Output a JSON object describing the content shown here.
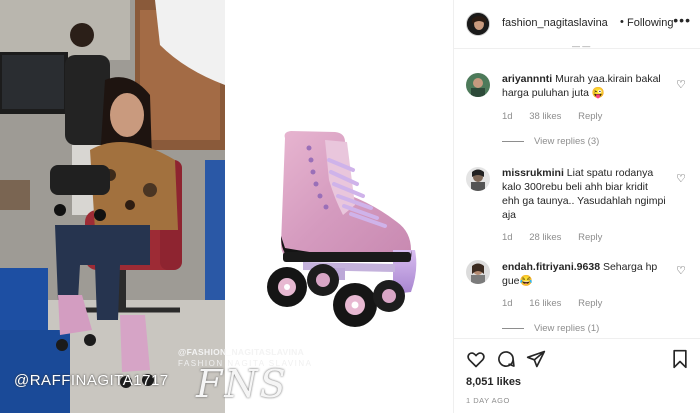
{
  "header": {
    "username": "fashion_nagitaslavina",
    "separator": "•",
    "follow_status": "Following",
    "more_icon": "more-horizontal-icon"
  },
  "comments": [
    {
      "username": "ariyannnti",
      "text": "Murah yaa.kirain bakal harga puluhan juta 😜",
      "time": "1d",
      "likes": "38 likes",
      "reply_label": "Reply",
      "view_replies": "View replies (3)"
    },
    {
      "username": "missrukmini",
      "text": "Liat spatu rodanya kalo 300rebu beli ahh biar kridit ehh ga taunya.. Yasudahlah ngimpi aja",
      "time": "1d",
      "likes": "28 likes",
      "reply_label": "Reply"
    },
    {
      "username": "endah.fitriyani.9638",
      "text": "Seharga hp gue😂",
      "time": "1d",
      "likes": "16 likes",
      "reply_label": "Reply",
      "view_replies": "View replies (1)"
    }
  ],
  "actions": {
    "likes": "8,051 likes",
    "time_ago": "1 DAY AGO"
  },
  "overlay": {
    "handle": "@RAFFINAGITA1717",
    "watermark_handle": "@FASHION_NAGITASLAVINA",
    "watermark_name": "FASHION NAGITA SLAVINA",
    "signature": "FNS"
  },
  "colors": {
    "text": "#262626",
    "muted": "#8e8e8e",
    "border": "#efefef",
    "skate_pink": "#d8a3c4",
    "skate_lilac": "#c9a7e0"
  }
}
